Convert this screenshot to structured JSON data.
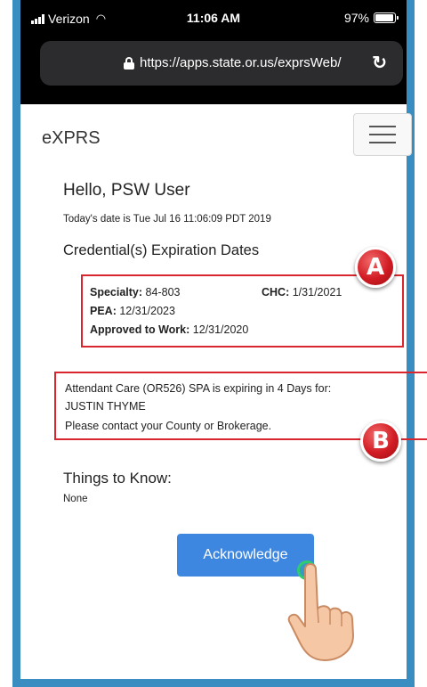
{
  "status_bar": {
    "carrier": "Verizon",
    "time": "11:06 AM",
    "battery": "97%",
    "battery_level": 0.97
  },
  "browser": {
    "url": "https://apps.state.or.us/exprsWeb/",
    "reload_icon": "reload-icon",
    "lock_icon": "lock-icon"
  },
  "header": {
    "title": "eXPRS",
    "menu_icon": "hamburger-menu-icon"
  },
  "main": {
    "greeting": "Hello, PSW User",
    "date_line": "Today's date is Tue Jul 16 11:06:09 PDT 2019",
    "credentials_heading": "Credential(s) Expiration Dates",
    "credentials": {
      "specialty_label": "Specialty:",
      "specialty_value": "84-803",
      "chc_label": "CHC:",
      "chc_value": "1/31/2021",
      "pea_label": "PEA:",
      "pea_value": "12/31/2023",
      "approved_label": "Approved to Work:",
      "approved_value": "12/31/2020"
    },
    "notice": {
      "line1": "Attendant Care (OR526) SPA is expiring in 4 Days for:",
      "line2": "JUSTIN THYME",
      "line3": "Please contact your County or Brokerage."
    },
    "things_heading": "Things to Know:",
    "things_value": "None",
    "acknowledge_label": "Acknowledge"
  },
  "annotations": {
    "marker_a": "A",
    "marker_b": "B",
    "box_color": "#d9252e"
  },
  "colors": {
    "frame": "#3a8dc1",
    "button": "#3e87e0"
  }
}
